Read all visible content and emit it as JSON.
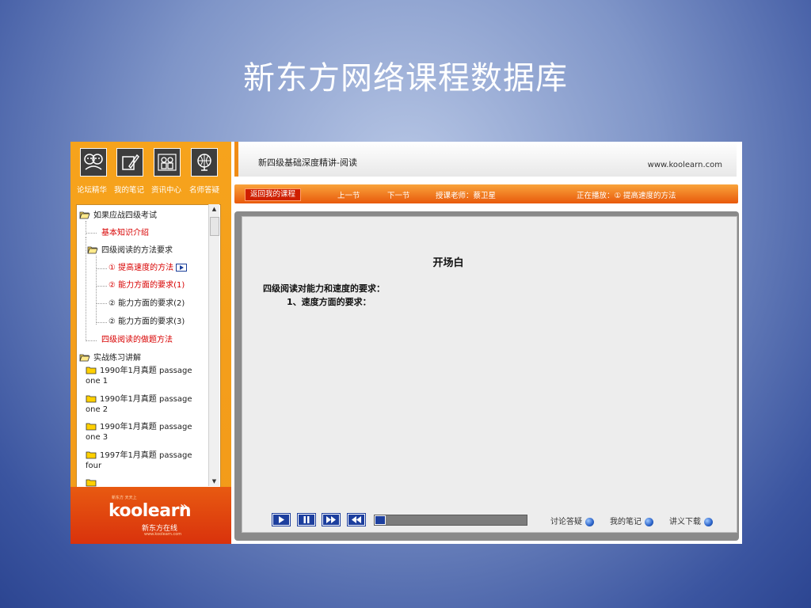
{
  "slide_title": "新东方网络课程数据库",
  "nav": {
    "labels": [
      "论坛精华",
      "我的笔记",
      "资讯中心",
      "名师答疑"
    ]
  },
  "tree": {
    "root": "如果应战四级考试",
    "basic": "基本知识介绍",
    "method": "四级阅读的方法要求",
    "sub1": "① 提高速度的方法",
    "sub2": "② 能力方面的要求(1)",
    "sub3": "② 能力方面的要求(2)",
    "sub4": "② 能力方面的要求(3)",
    "solve": "四级阅读的做题方法",
    "practice": "实战练习讲解",
    "p1": "1990年1月真题 passage one 1",
    "p2": "1990年1月真题 passage one 2",
    "p3": "1990年1月真题 passage one 3",
    "p4": "1997年1月真题 passage four"
  },
  "logo": {
    "small": "新东方 天天上",
    "brand": "koolearn",
    "cn": "新东方在线",
    "url": "www.koolearn.com"
  },
  "header": {
    "title": "新四级基础深度精讲-阅读",
    "url": "www.koolearn.com"
  },
  "toolbar": {
    "back": "返回我的课程",
    "prev": "上一节",
    "next": "下一节",
    "teacher": "授课老师：蔡卫星",
    "now_playing": "正在播放：① 提高速度的方法"
  },
  "content": {
    "title": "开场白",
    "line1": "四级阅读对能力和速度的要求：",
    "line2": "1、速度方面的要求："
  },
  "bottom": {
    "discuss": "讨论答疑",
    "notes": "我的笔记",
    "handout": "讲义下载"
  },
  "colors": {
    "orange": "#f6a31c",
    "red_text": "#d80000",
    "control_blue": "#1d3f9e"
  }
}
